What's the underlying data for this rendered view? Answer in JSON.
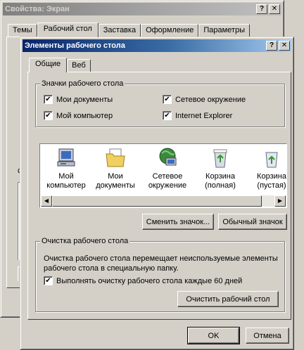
{
  "back_window": {
    "title": "Свойства: Экран",
    "help_button": "?",
    "close_button": "✕",
    "tabs": [
      "Темы",
      "Рабочий стол",
      "Заставка",
      "Оформление",
      "Параметры"
    ],
    "selected_tab": "Рабочий стол",
    "partial_label": "с"
  },
  "dialog": {
    "title": "Элементы рабочего стола",
    "help_button": "?",
    "close_button": "✕",
    "tabs": [
      "Общие",
      "Веб"
    ],
    "selected_tab": "Общие",
    "icons_group": {
      "label": "Значки рабочего стола",
      "checkboxes": [
        {
          "label": "Мои документы",
          "checked": true
        },
        {
          "label": "Сетевое окружение",
          "checked": true
        },
        {
          "label": "Мой компьютер",
          "checked": true
        },
        {
          "label": "Internet Explorer",
          "checked": true
        }
      ]
    },
    "icon_list": [
      {
        "line1": "Мой",
        "line2": "компьютер",
        "icon": "my-computer-icon"
      },
      {
        "line1": "Мои",
        "line2": "документы",
        "icon": "my-documents-icon"
      },
      {
        "line1": "Сетевое",
        "line2": "окружение",
        "icon": "network-places-icon"
      },
      {
        "line1": "Корзина",
        "line2": "(полная)",
        "icon": "recycle-bin-full-icon"
      },
      {
        "line1": "Корзина",
        "line2": "(пустая)",
        "icon": "recycle-bin-empty-icon"
      }
    ],
    "change_icon_button": "Сменить значок...",
    "default_icon_button": "Обычный значок",
    "cleanup_group": {
      "label": "Очистка рабочего стола",
      "description_line1": "Очистка рабочего стола перемещает неиспользуемые элементы",
      "description_line2": "рабочего стола в специальную папку.",
      "checkbox": {
        "label": "Выполнять очистку рабочего стола каждые 60 дней",
        "checked": true
      },
      "cleanup_button": "Очистить рабочий стол"
    },
    "ok_button": "OK",
    "cancel_button": "Отмена"
  },
  "colors": {
    "face": "#d4d0c8",
    "active_title_start": "#0a246a",
    "active_title_end": "#a6caf0",
    "inactive_title": "#808080"
  }
}
